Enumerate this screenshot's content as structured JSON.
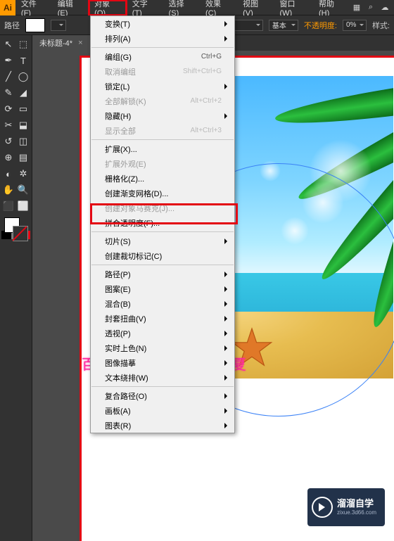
{
  "menubar": {
    "logo": "Ai",
    "items": [
      "文件(F)",
      "编辑(E)",
      "对象(O)",
      "文字(T)",
      "选择(S)",
      "效果(C)",
      "视图(V)",
      "窗口(W)",
      "帮助(H)"
    ],
    "active_index": 2
  },
  "ctrlbar": {
    "label_path": "路径",
    "stroke_empty": "▼",
    "basic_label": "基本",
    "opacity_label": "不透明度:",
    "opacity_value": "0%",
    "style_label": "样式:"
  },
  "doc_tab": {
    "title": "未标题-4*",
    "close": "×"
  },
  "menu": {
    "groups": [
      [
        {
          "label": "变换(T)",
          "sub": true,
          "en": true
        },
        {
          "label": "排列(A)",
          "sub": true,
          "en": true
        }
      ],
      [
        {
          "label": "编组(G)",
          "shortcut": "Ctrl+G",
          "en": true
        },
        {
          "label": "取消编组",
          "shortcut": "Shift+Ctrl+G",
          "en": false
        },
        {
          "label": "锁定(L)",
          "sub": true,
          "en": true
        },
        {
          "label": "全部解锁(K)",
          "shortcut": "Alt+Ctrl+2",
          "en": false
        },
        {
          "label": "隐藏(H)",
          "sub": true,
          "en": true
        },
        {
          "label": "显示全部",
          "shortcut": "Alt+Ctrl+3",
          "en": false
        }
      ],
      [
        {
          "label": "扩展(X)...",
          "en": true
        },
        {
          "label": "扩展外观(E)",
          "en": false
        },
        {
          "label": "栅格化(Z)...",
          "en": true
        },
        {
          "label": "创建渐变网格(D)...",
          "en": true
        },
        {
          "label": "创建对象马赛克(J)...",
          "en": false
        },
        {
          "label": "拼合透明度(F)...",
          "en": true,
          "hl": true
        }
      ],
      [
        {
          "label": "切片(S)",
          "sub": true,
          "en": true
        },
        {
          "label": "创建裁切标记(C)",
          "en": true
        }
      ],
      [
        {
          "label": "路径(P)",
          "sub": true,
          "en": true
        },
        {
          "label": "图案(E)",
          "sub": true,
          "en": true
        },
        {
          "label": "混合(B)",
          "sub": true,
          "en": true
        },
        {
          "label": "封套扭曲(V)",
          "sub": true,
          "en": true
        },
        {
          "label": "透视(P)",
          "sub": true,
          "en": true
        },
        {
          "label": "实时上色(N)",
          "sub": true,
          "en": true
        },
        {
          "label": "图像描摹",
          "sub": true,
          "en": true
        },
        {
          "label": "文本绕排(W)",
          "sub": true,
          "en": true
        }
      ],
      [
        {
          "label": "复合路径(O)",
          "sub": true,
          "en": true
        },
        {
          "label": "画板(A)",
          "sub": true,
          "en": true
        },
        {
          "label": "图表(R)",
          "sub": true,
          "en": true
        }
      ]
    ]
  },
  "watermark": "百度ID：sunnyMelody夏",
  "brand": {
    "title": "溜溜自学",
    "sub": "zixue.3d66.com"
  },
  "tool_glyphs": [
    "↖",
    "⬚",
    "✒",
    "T",
    "╱",
    "◯",
    "✎",
    "◢",
    "⟳",
    "▭",
    "✂",
    "⬓",
    "↺",
    "◫",
    "⊕",
    "▤",
    "◐",
    "✲",
    "✋",
    "🔍",
    "⬛",
    "⬜"
  ]
}
